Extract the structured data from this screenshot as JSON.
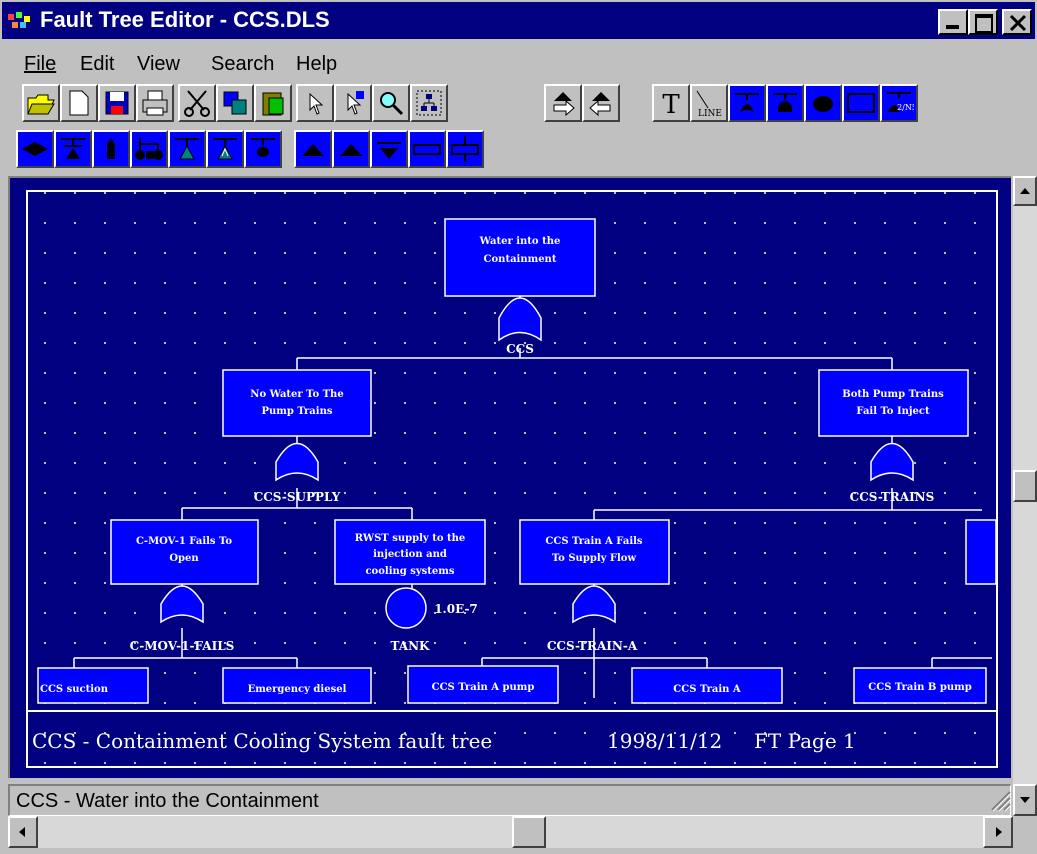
{
  "window": {
    "title": "Fault Tree Editor - CCS.DLS",
    "controls": [
      "minimize",
      "maximize",
      "close"
    ]
  },
  "menu": {
    "items": [
      "File",
      "Edit",
      "View",
      "Search",
      "Help"
    ]
  },
  "toolbar": {
    "row1": [
      "open-folder-icon",
      "new-file-icon",
      "save-icon",
      "print-icon",
      "cut-icon",
      "copy-icon",
      "paste-icon",
      "pointer-select-icon",
      "pointer-add-icon",
      "zoom-icon",
      "tree-select-icon",
      "move-right-icon",
      "move-left-icon",
      "text-tool-icon",
      "line-tool-icon",
      "or-gate-tool-icon",
      "and-gate-tool-icon",
      "basic-event-tool-icon",
      "rectangle-tool-icon",
      "vote-gate-tool-icon"
    ],
    "row1_labels": {
      "text": "T",
      "line": "LINE",
      "vote": "2/N5"
    },
    "row2": [
      "diamond-event-icon",
      "transfer-gate-icon",
      "house-event-icon",
      "connect-gates-icon",
      "inhibit-gate-icon",
      "priority-and-gate-icon",
      "gate-with-event-icon",
      "transfer-in-icon",
      "transfer-out-icon",
      "transfer-down-icon",
      "rectangle-small-icon",
      "cross-connector-icon"
    ]
  },
  "fault_tree": {
    "top_gate": {
      "text": [
        "Water into the",
        "Containment"
      ],
      "label": "CCS"
    },
    "gates": [
      {
        "text": [
          "No Water To The",
          "Pump Trains"
        ],
        "label": "CCS-SUPPLY"
      },
      {
        "text": [
          "Both Pump Trains",
          "Fail To Inject"
        ],
        "label": "CCS-TRAINS"
      },
      {
        "text": [
          "C-MOV-1 Fails To",
          "Open"
        ],
        "label": "C-MOV-1-FAILS"
      },
      {
        "text": [
          "RWST supply to the",
          "injection and",
          "cooling systems"
        ],
        "label": "TANK",
        "probability": "1.0E-7"
      },
      {
        "text": [
          "CCS Train A Fails",
          "To Supply Flow"
        ],
        "label": "CCS-TRAIN-A"
      }
    ],
    "partial_boxes": [
      "CCS suction",
      "Emergency diesel",
      "CCS Train A pump",
      "CCS Train A",
      "CCS Train B pump"
    ],
    "footer": {
      "description": "CCS  -   Containment Cooling System fault tree",
      "date": "1998/11/12",
      "page": "FT Page   1"
    }
  },
  "statusbar": {
    "text": "CCS - Water into the  Containment"
  },
  "colors": {
    "titlebar": "#000080",
    "canvas": "#000080",
    "node_fill": "#0000ff",
    "lines": "#ffffff",
    "window": "#c0c0c0"
  }
}
